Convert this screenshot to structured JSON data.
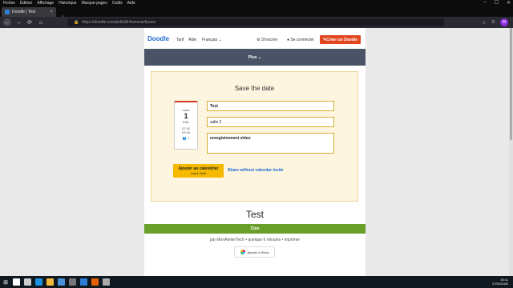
{
  "menubar": [
    "Fichier",
    "Édition",
    "Affichage",
    "Historique",
    "Marque-pages",
    "Outils",
    "Aide"
  ],
  "window_controls": [
    "–",
    "☐",
    "✕"
  ],
  "tab": {
    "title": "Doodle | Test",
    "close": "×"
  },
  "new_tab": "+",
  "nav": {
    "back": "←",
    "forward": "→",
    "reload": "⟳",
    "home": "⌂"
  },
  "url": "https://doodle.com/poll/u8r4cmzxaefiyune",
  "nav_right": {
    "star": "☆",
    "menu": "≡",
    "avatar": "M"
  },
  "header": {
    "logo": "Doodle",
    "links": [
      "Tarif",
      "Aide",
      "Français ⌄"
    ],
    "signup": "S'inscrire",
    "login": "Se connecter",
    "create": "Créer un Doodle"
  },
  "graybar": {
    "label": "Plus ⌄"
  },
  "card": {
    "title": "Save the date",
    "calendar": {
      "month": "mars",
      "day": "1",
      "weekday": "DIM.",
      "time_start": "07:30",
      "time_end": "09:45",
      "participants": "1"
    },
    "fields": {
      "name": "Test",
      "location": "salle 2",
      "note": "enregistrement video"
    },
    "add_button": {
      "label": "Ajouter au calendrier",
      "sub": "Log in first!"
    },
    "share": "Share without calendar invite"
  },
  "poll": {
    "title": "Test",
    "status": "Clos",
    "byline": "par MonAtelierTech • quelque 6 minutes • imprimer",
    "slack": "Ajouter à Slack"
  },
  "taskbar": {
    "start": "⊞",
    "icons": [
      {
        "name": "search",
        "color": "#ffffff"
      },
      {
        "name": "task-view",
        "color": "#cccccc"
      },
      {
        "name": "edge",
        "color": "#1f8fe0"
      },
      {
        "name": "explorer",
        "color": "#f3b73b"
      },
      {
        "name": "store",
        "color": "#4a90d9"
      },
      {
        "name": "calculator",
        "color": "#777777"
      },
      {
        "name": "mail",
        "color": "#2f7fd8"
      },
      {
        "name": "firefox",
        "color": "#e66000"
      },
      {
        "name": "settings",
        "color": "#aaaaaa"
      }
    ]
  },
  "tray": {
    "time": "15:11",
    "date": "27/02/2020"
  }
}
